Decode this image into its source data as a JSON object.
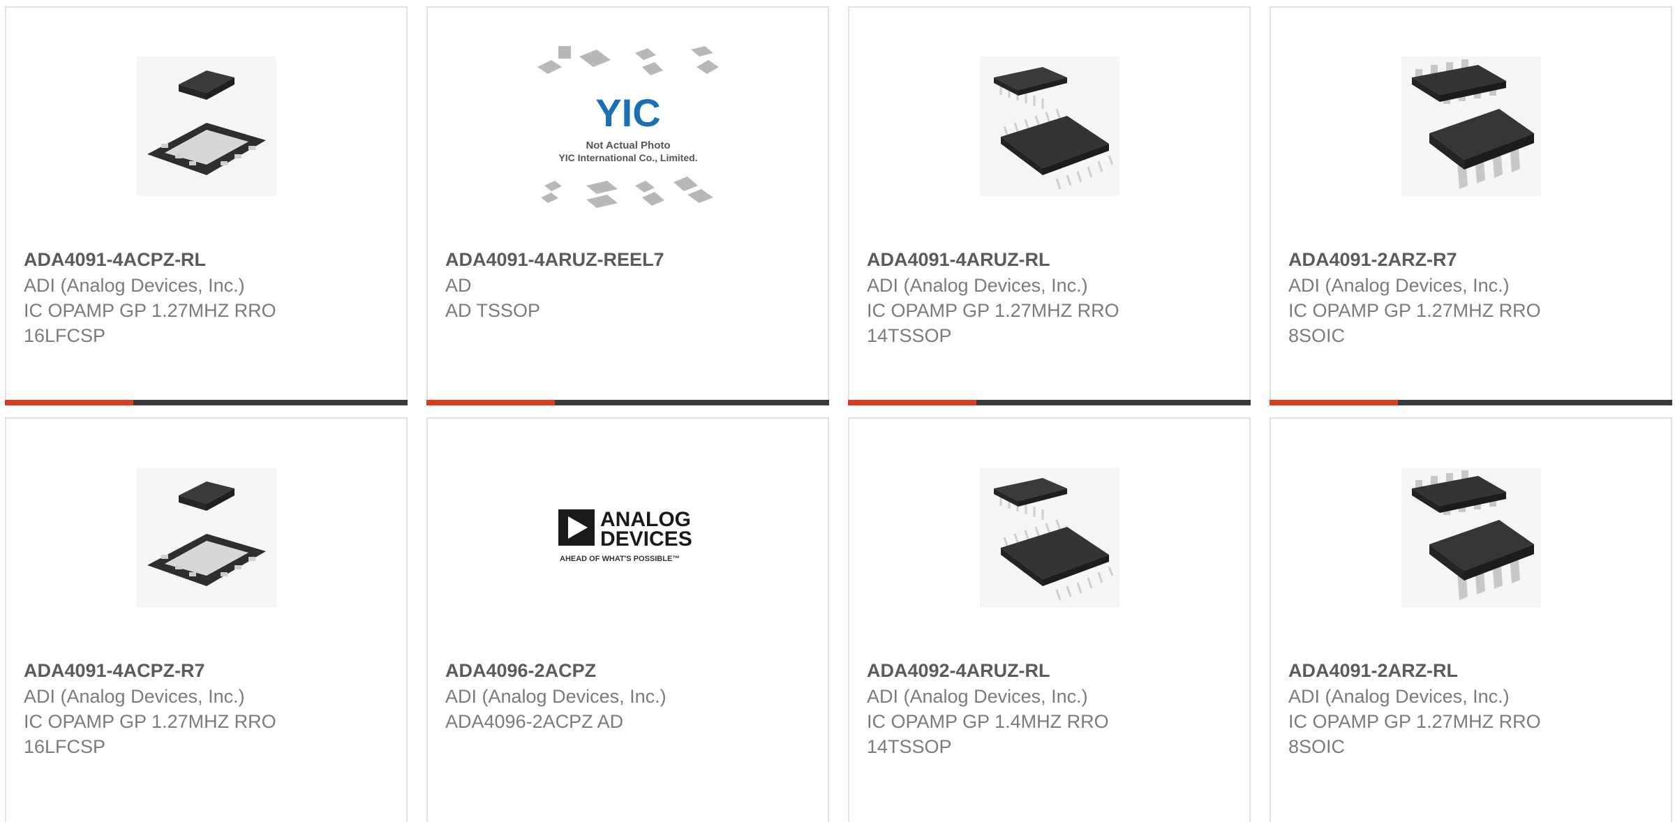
{
  "accent_color": "#e03a1c",
  "bar_color": "#3a3a3a",
  "products": [
    {
      "part": "ADA4091-4ACPZ-RL",
      "maker": "ADI (Analog Devices, Inc.)",
      "desc1": "IC OPAMP GP 1.27MHZ RRO",
      "desc2": "16LFCSP",
      "image": "lfcsp-chip-icon"
    },
    {
      "part": "ADA4091-4ARUZ-REEL7",
      "maker": "AD",
      "desc1": "AD TSSOP",
      "desc2": "",
      "image": "yic-placeholder-icon",
      "image_text": {
        "logo": "YIC",
        "line1": "Not Actual Photo",
        "line2": "YIC International Co., Limited."
      }
    },
    {
      "part": "ADA4091-4ARUZ-RL",
      "maker": "ADI (Analog Devices, Inc.)",
      "desc1": "IC OPAMP GP 1.27MHZ RRO",
      "desc2": "14TSSOP",
      "image": "tssop-chip-icon"
    },
    {
      "part": "ADA4091-2ARZ-R7",
      "maker": "ADI (Analog Devices, Inc.)",
      "desc1": "IC OPAMP GP 1.27MHZ RRO",
      "desc2": "8SOIC",
      "image": "soic-chip-icon"
    },
    {
      "part": "ADA4091-4ACPZ-R7",
      "maker": "ADI (Analog Devices, Inc.)",
      "desc1": "IC OPAMP GP 1.27MHZ RRO",
      "desc2": "16LFCSP",
      "image": "lfcsp-chip-icon"
    },
    {
      "part": "ADA4096-2ACPZ",
      "maker": "ADI (Analog Devices, Inc.)",
      "desc1": "ADA4096-2ACPZ AD",
      "desc2": "",
      "image": "analog-devices-logo-icon",
      "image_text": {
        "line1": "ANALOG",
        "line2": "DEVICES",
        "tagline": "AHEAD OF WHAT'S POSSIBLE™"
      }
    },
    {
      "part": "ADA4092-4ARUZ-RL",
      "maker": "ADI (Analog Devices, Inc.)",
      "desc1": "IC OPAMP GP 1.4MHZ RRO",
      "desc2": "14TSSOP",
      "image": "tssop-chip-icon"
    },
    {
      "part": "ADA4091-2ARZ-RL",
      "maker": "ADI (Analog Devices, Inc.)",
      "desc1": "IC OPAMP GP 1.27MHZ RRO",
      "desc2": "8SOIC",
      "image": "soic-chip-icon"
    }
  ]
}
